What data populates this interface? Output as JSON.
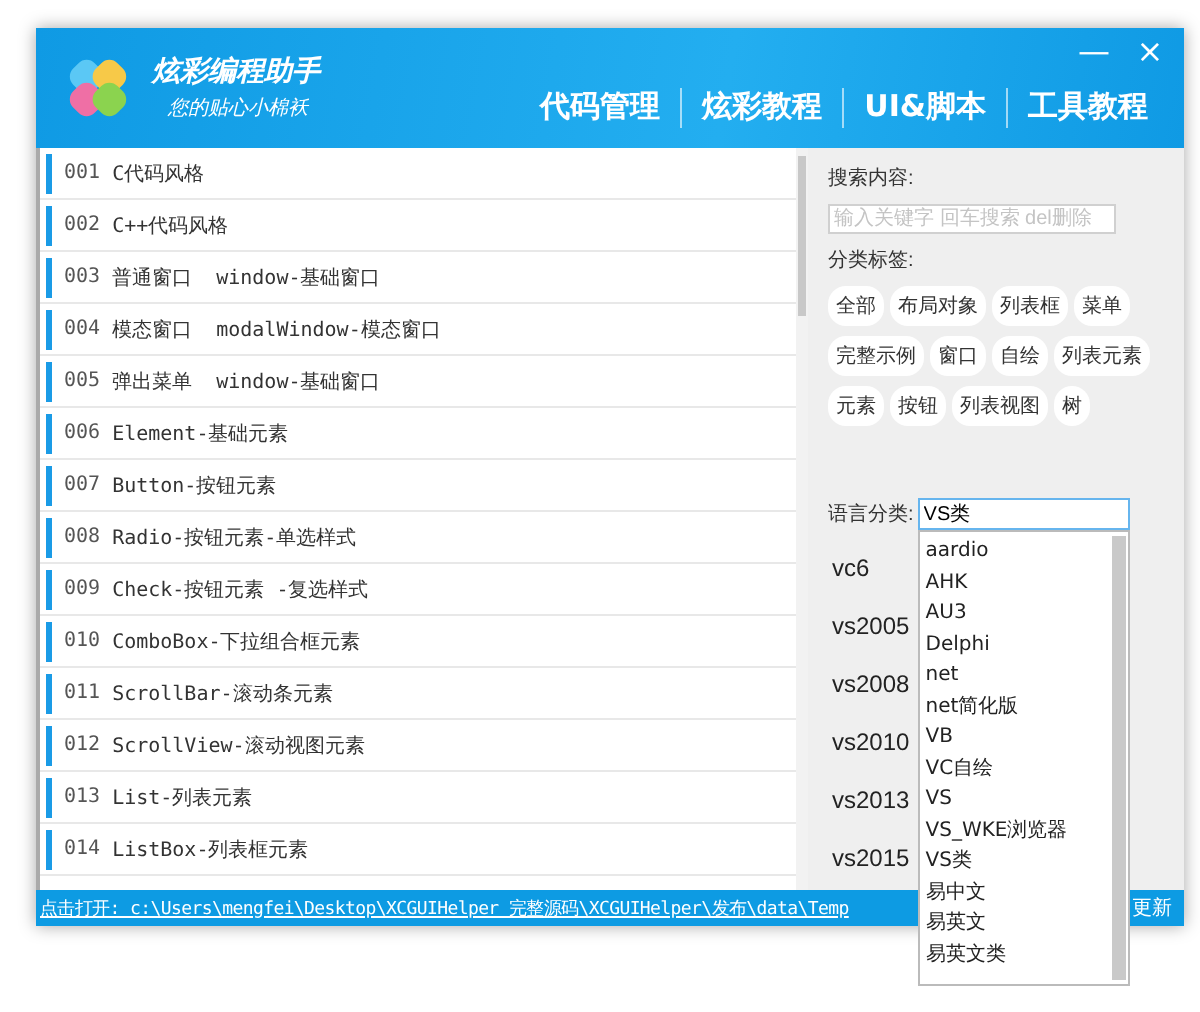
{
  "header": {
    "title": "炫彩编程助手",
    "subtitle": "您的贴心小棉袄",
    "tabs": [
      "代码管理",
      "炫彩教程",
      "UI&脚本",
      "工具教程"
    ],
    "minimize": "—",
    "close": "×"
  },
  "list": [
    {
      "number": "001",
      "label": "C代码风格"
    },
    {
      "number": "002",
      "label": "C++代码风格"
    },
    {
      "number": "003",
      "label": "普通窗口  window-基础窗口"
    },
    {
      "number": "004",
      "label": "模态窗口  modalWindow-模态窗口"
    },
    {
      "number": "005",
      "label": "弹出菜单  window-基础窗口"
    },
    {
      "number": "006",
      "label": "Element-基础元素"
    },
    {
      "number": "007",
      "label": "Button-按钮元素"
    },
    {
      "number": "008",
      "label": "Radio-按钮元素-单选样式"
    },
    {
      "number": "009",
      "label": "Check-按钮元素 -复选样式"
    },
    {
      "number": "010",
      "label": "ComboBox-下拉组合框元素"
    },
    {
      "number": "011",
      "label": "ScrollBar-滚动条元素"
    },
    {
      "number": "012",
      "label": "ScrollView-滚动视图元素"
    },
    {
      "number": "013",
      "label": "List-列表元素"
    },
    {
      "number": "014",
      "label": "ListBox-列表框元素"
    }
  ],
  "search": {
    "label": "搜索内容:",
    "placeholder": "输入关键字 回车搜索 del删除"
  },
  "tags": {
    "label": "分类标签:",
    "items": [
      "全部",
      "布局对象",
      "列表框",
      "菜单",
      "完整示例",
      "窗口",
      "自绘",
      "列表元素",
      "元素",
      "按钮",
      "列表视图",
      "树"
    ]
  },
  "language": {
    "label": "语言分类:",
    "value": "VS类",
    "options": [
      "aardio",
      "AHK",
      "AU3",
      "Delphi",
      "net",
      "net简化版",
      "VB",
      "VC自绘",
      "VS",
      "VS_WKE浏览器",
      "VS类",
      "易中文",
      "易英文",
      "易英文类"
    ]
  },
  "versions": [
    "vc6",
    "vs2005",
    "vs2008",
    "vs2010",
    "vs2013",
    "vs2015"
  ],
  "status_bar": {
    "path": "点击打开: c:\\Users\\mengfei\\Desktop\\XCGUIHelper 完整源码\\XCGUIHelper\\发布\\data\\Temp",
    "right": "更新"
  }
}
